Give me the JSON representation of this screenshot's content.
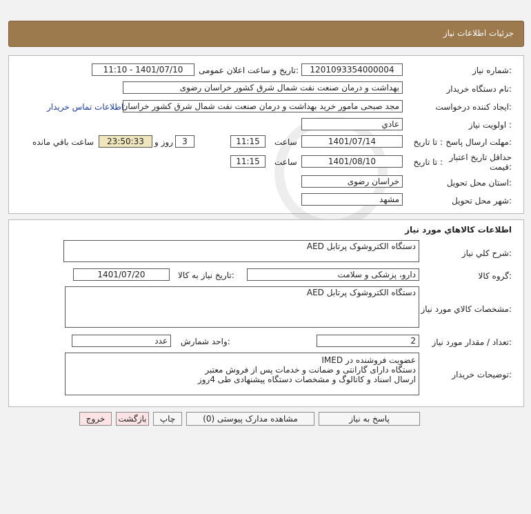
{
  "header": {
    "title": "جزئیات اطلاعات نیاز"
  },
  "info": {
    "need_number": {
      "label": "شماره نیاز:",
      "value": "1201093354000004"
    },
    "announce": {
      "label": "تاریخ و ساعت اعلان عمومی:",
      "value": "1401/07/10 - 11:10"
    },
    "buyer_org": {
      "label": "نام دستگاه خریدار:",
      "value": "بهداشت و درمان صنعت نفت شمال شرق کشور   خراسان رضوی"
    },
    "requester": {
      "label": "ایجاد کننده درخواست:",
      "value": "مجد صبحی مامور خرید بهداشت و درمان صنعت نفت شمال شرق کشور   خراسان رضوی"
    },
    "contact_link": "اطلاعات تماس خریدار",
    "priority": {
      "label": "اولویت نیاز :",
      "value": "عادي"
    },
    "deadline": {
      "label": "مهلت ارسال پاسخ:",
      "to_date_label": "تا تاریخ :",
      "date": "1401/07/14",
      "time_label": "ساعت",
      "time": "11:15",
      "days": "3",
      "days_label": "روز و",
      "remaining": "23:50:33",
      "remaining_label": "ساعت باقي مانده"
    },
    "validity": {
      "label": "حداقل تاریخ اعتبار قیمت:",
      "to_date_label": "تا تاریخ :",
      "date": "1401/08/10",
      "time_label": "ساعت",
      "time": "11:15"
    },
    "province": {
      "label": "استان محل تحویل:",
      "value": "خراسان رضوی"
    },
    "city": {
      "label": "شهر محل تحویل:",
      "value": "مشهد"
    }
  },
  "goods": {
    "title": "اطلاعات کالاهاي مورد نياز",
    "summary": {
      "label": "شرح کلي نياز:",
      "value": "دستگاه الکتروشوک پرتابل AED"
    },
    "group": {
      "label": "گروه کالا:",
      "value": "دارو، پزشکی و سلامت"
    },
    "need_date": {
      "label": "تاریخ نیاز به کالا:",
      "value": "1401/07/20"
    },
    "specs": {
      "label": "مشخصات کالاي مورد نياز:",
      "value": "دستگاه الکتروشوک پرتابل AED"
    },
    "quantity": {
      "label": "تعداد / مقدار مورد نیاز:",
      "value": "2"
    },
    "unit": {
      "label": "واحد شمارش:",
      "value": "عدد"
    },
    "buyer_notes": {
      "label": "توضیحات خریدار:",
      "lines": [
        "عضویت فروشنده در IMED",
        "دستگاه دارای گارانتی و ضمانت و خدمات پس از فروش معتبر",
        "ارسال اسناد و کاتالوگ و مشخصات دستگاه پیشنهادی طی 4روز"
      ]
    }
  },
  "buttons": {
    "respond": "پاسخ به نياز",
    "attachments": "مشاهده مدارک پیوستی (0)",
    "print": "چاپ",
    "back": "بازگشت",
    "exit": "خروج"
  },
  "colors": {
    "header_bg": "#9c7a4e",
    "timer_bg": "#efe6bd",
    "link": "#1a3c9c",
    "exit_bg": "#fde3e3"
  }
}
